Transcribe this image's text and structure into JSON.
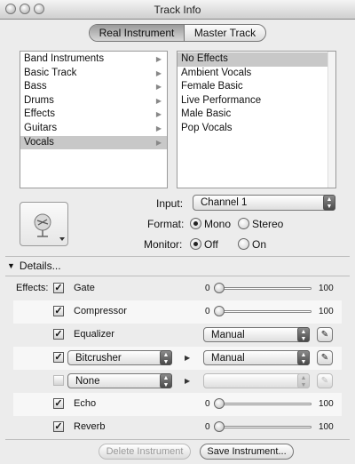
{
  "window": {
    "title": "Track Info"
  },
  "tabs": [
    {
      "label": "Real Instrument",
      "selected": true
    },
    {
      "label": "Master Track",
      "selected": false
    }
  ],
  "categories": [
    {
      "label": "Band Instruments",
      "selected": false
    },
    {
      "label": "Basic Track",
      "selected": false
    },
    {
      "label": "Bass",
      "selected": false
    },
    {
      "label": "Drums",
      "selected": false
    },
    {
      "label": "Effects",
      "selected": false
    },
    {
      "label": "Guitars",
      "selected": false
    },
    {
      "label": "Vocals",
      "selected": true
    }
  ],
  "presets": [
    {
      "label": "No Effects",
      "selected": true
    },
    {
      "label": "Ambient Vocals",
      "selected": false
    },
    {
      "label": "Female Basic",
      "selected": false
    },
    {
      "label": "Live Performance",
      "selected": false
    },
    {
      "label": "Male Basic",
      "selected": false
    },
    {
      "label": "Pop Vocals",
      "selected": false
    }
  ],
  "input": {
    "label": "Input:",
    "value": "Channel 1"
  },
  "format": {
    "label": "Format:",
    "options": [
      "Mono",
      "Stereo"
    ],
    "selected": "Mono"
  },
  "monitor": {
    "label": "Monitor:",
    "options": [
      "Off",
      "On"
    ],
    "selected": "Off"
  },
  "details": {
    "label": "Details..."
  },
  "effects": {
    "label": "Effects:",
    "gate": {
      "name": "Gate",
      "checked": true,
      "min": "0",
      "max": "100",
      "level": 0
    },
    "compressor": {
      "name": "Compressor",
      "checked": true,
      "min": "0",
      "max": "100",
      "level": 0
    },
    "equalizer": {
      "name": "Equalizer",
      "checked": true,
      "preset": "Manual"
    },
    "slot1": {
      "checked": true,
      "effect": "Bitcrusher",
      "preset": "Manual"
    },
    "slot2": {
      "checked": false,
      "effect": "None",
      "preset": ""
    },
    "echo": {
      "name": "Echo",
      "checked": true,
      "min": "0",
      "max": "100",
      "level": 0
    },
    "reverb": {
      "name": "Reverb",
      "checked": true,
      "min": "0",
      "max": "100",
      "level": 0
    }
  },
  "buttons": {
    "delete": "Delete Instrument",
    "save": "Save Instrument..."
  },
  "icons": {
    "close": "close-icon",
    "minimize": "minimize-icon",
    "zoom": "zoom-icon",
    "instrument": "microphone-icon",
    "edit": "pencil-icon",
    "disclosure": "triangle-down-icon"
  }
}
